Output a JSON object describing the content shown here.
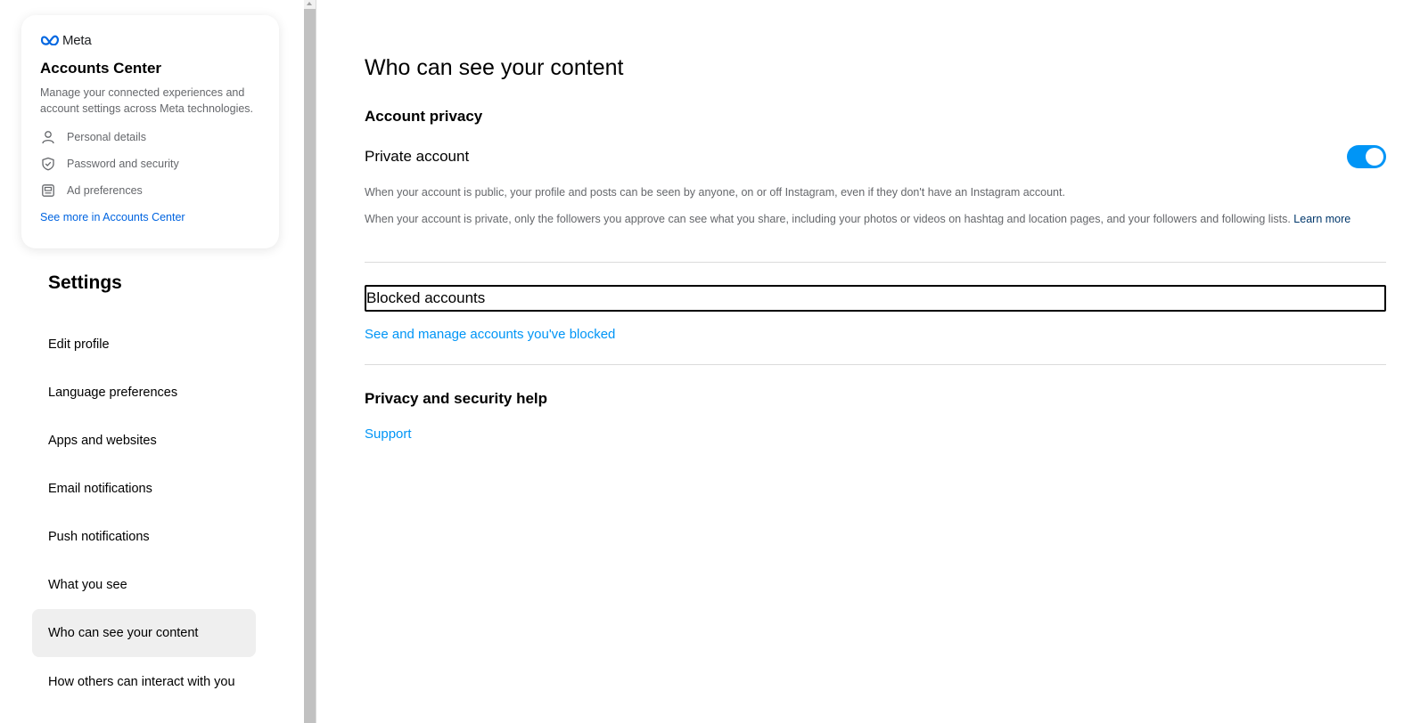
{
  "accounts_center": {
    "brand": "Meta",
    "title": "Accounts Center",
    "description": "Manage your connected experiences and account settings across Meta technologies.",
    "items": [
      {
        "label": "Personal details",
        "icon": "person-icon"
      },
      {
        "label": "Password and security",
        "icon": "shield-check-icon"
      },
      {
        "label": "Ad preferences",
        "icon": "ad-preferences-icon"
      }
    ],
    "see_more": "See more in Accounts Center"
  },
  "settings": {
    "title": "Settings",
    "nav": [
      {
        "label": "Edit profile",
        "active": false
      },
      {
        "label": "Language preferences",
        "active": false
      },
      {
        "label": "Apps and websites",
        "active": false
      },
      {
        "label": "Email notifications",
        "active": false
      },
      {
        "label": "Push notifications",
        "active": false
      },
      {
        "label": "What you see",
        "active": false
      },
      {
        "label": "Who can see your content",
        "active": true
      },
      {
        "label": "How others can interact with you",
        "active": false
      }
    ]
  },
  "main": {
    "title": "Who can see your content",
    "account_privacy": {
      "heading": "Account privacy",
      "private_label": "Private account",
      "private_enabled": true,
      "public_help": "When your account is public, your profile and posts can be seen by anyone, on or off Instagram, even if they don't have an Instagram account.",
      "private_help": "When your account is private, only the followers you approve can see what you share, including your photos or videos on hashtag and location pages, and your followers and following lists.",
      "learn_more": "Learn more"
    },
    "blocked": {
      "heading": "Blocked accounts",
      "link": "See and manage accounts you've blocked"
    },
    "help": {
      "heading": "Privacy and security help",
      "link": "Support"
    }
  },
  "colors": {
    "accent": "#0095f6",
    "meta_link": "#0064e0",
    "active_nav_bg": "#efefef"
  }
}
